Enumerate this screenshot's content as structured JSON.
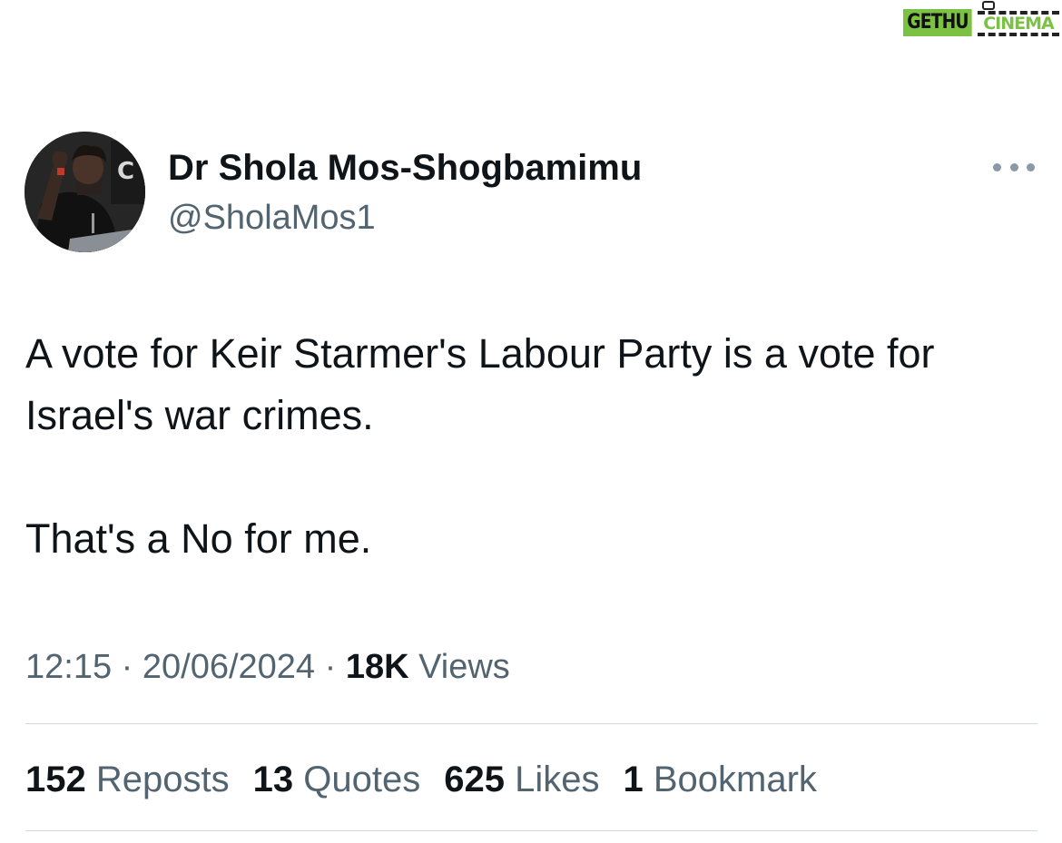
{
  "watermark": {
    "part1": "GETHU",
    "part2": "CINEMA"
  },
  "author": {
    "display_name": "Dr Shola Mos-Shogbamimu",
    "handle": "@SholaMos1"
  },
  "tweet": {
    "paragraphs": [
      "A vote for Keir Starmer's Labour Party is a vote for Israel's war crimes.",
      "That's a No for me."
    ]
  },
  "meta": {
    "time": "12:15",
    "separator": "·",
    "date": "20/06/2024",
    "views_count": "18K",
    "views_label": "Views"
  },
  "stats": [
    {
      "count": "152",
      "label": "Reposts"
    },
    {
      "count": "13",
      "label": "Quotes"
    },
    {
      "count": "625",
      "label": "Likes"
    },
    {
      "count": "1",
      "label": "Bookmark"
    }
  ],
  "icons": {
    "more": "more-horizontal-icon"
  },
  "colors": {
    "text_primary": "#0f1419",
    "text_secondary": "#536471",
    "divider": "#cfd9de",
    "watermark_green": "#7cc242"
  }
}
